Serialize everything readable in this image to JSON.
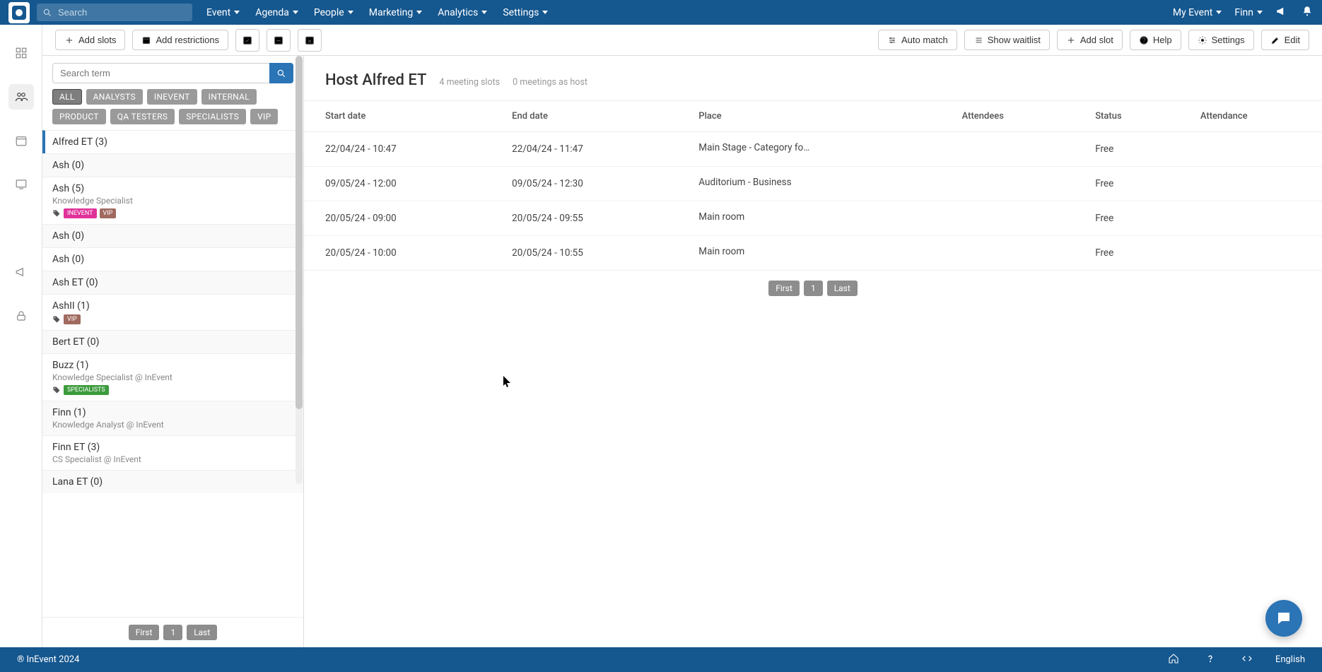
{
  "top": {
    "search_placeholder": "Search",
    "menu": [
      "Event",
      "Agenda",
      "People",
      "Marketing",
      "Analytics",
      "Settings"
    ],
    "right": {
      "my_event": "My Event",
      "user": "Finn"
    }
  },
  "toolbar": {
    "add_slots": "Add slots",
    "add_restrictions": "Add restrictions",
    "auto_match": "Auto match",
    "show_waitlist": "Show waitlist",
    "add_slot": "Add slot",
    "help": "Help",
    "settings": "Settings",
    "edit": "Edit"
  },
  "side": {
    "search_placeholder": "Search term",
    "chips": [
      "ALL",
      "ANALYSTS",
      "INEVENT",
      "INTERNAL",
      "PRODUCT",
      "QA TESTERS",
      "SPECIALISTS",
      "VIP"
    ],
    "selected_chip": "ALL",
    "people": [
      {
        "name": "Alfred ET (3)",
        "selected": true
      },
      {
        "name": "Ash (0)"
      },
      {
        "name": "Ash (5)",
        "sub": "Knowledge Specialist",
        "tags": [
          {
            "t": "INEVENT",
            "c": "pink"
          },
          {
            "t": "VIP",
            "c": "brown"
          }
        ]
      },
      {
        "name": "Ash (0)"
      },
      {
        "name": "Ash (0)"
      },
      {
        "name": "Ash ET (0)"
      },
      {
        "name": "AshII (1)",
        "tags": [
          {
            "t": "VIP",
            "c": "brown"
          }
        ]
      },
      {
        "name": "Bert ET (0)"
      },
      {
        "name": "Buzz (1)",
        "sub": "Knowledge Specialist @ InEvent",
        "tags": [
          {
            "t": "SPECIALISTS",
            "c": "green"
          }
        ]
      },
      {
        "name": "Finn (1)",
        "sub": "Knowledge Analyst @ InEvent"
      },
      {
        "name": "Finn ET (3)",
        "sub": "CS Specialist @ InEvent"
      },
      {
        "name": "Lana ET (0)"
      }
    ],
    "pager": {
      "first": "First",
      "page": "1",
      "last": "Last"
    }
  },
  "main": {
    "title": "Host Alfred ET",
    "meta1": "4 meeting slots",
    "meta2": "0 meetings as host",
    "columns": {
      "start": "Start date",
      "end": "End date",
      "place": "Place",
      "attendees": "Attendees",
      "status": "Status",
      "attendance": "Attendance"
    },
    "rows": [
      {
        "start": "22/04/24 - 10:47",
        "end": "22/04/24 - 11:47",
        "place": "Main Stage - Category for Ma...",
        "attendees": "",
        "status": "Free",
        "attendance": ""
      },
      {
        "start": "09/05/24 - 12:00",
        "end": "09/05/24 - 12:30",
        "place": "Auditorium - Business",
        "attendees": "",
        "status": "Free",
        "attendance": ""
      },
      {
        "start": "20/05/24 - 09:00",
        "end": "20/05/24 - 09:55",
        "place": "Main room",
        "attendees": "",
        "status": "Free",
        "attendance": ""
      },
      {
        "start": "20/05/24 - 10:00",
        "end": "20/05/24 - 10:55",
        "place": "Main room",
        "attendees": "",
        "status": "Free",
        "attendance": ""
      }
    ],
    "pager": {
      "first": "First",
      "page": "1",
      "last": "Last"
    }
  },
  "footer": {
    "copyright": "® InEvent 2024",
    "lang": "English"
  }
}
